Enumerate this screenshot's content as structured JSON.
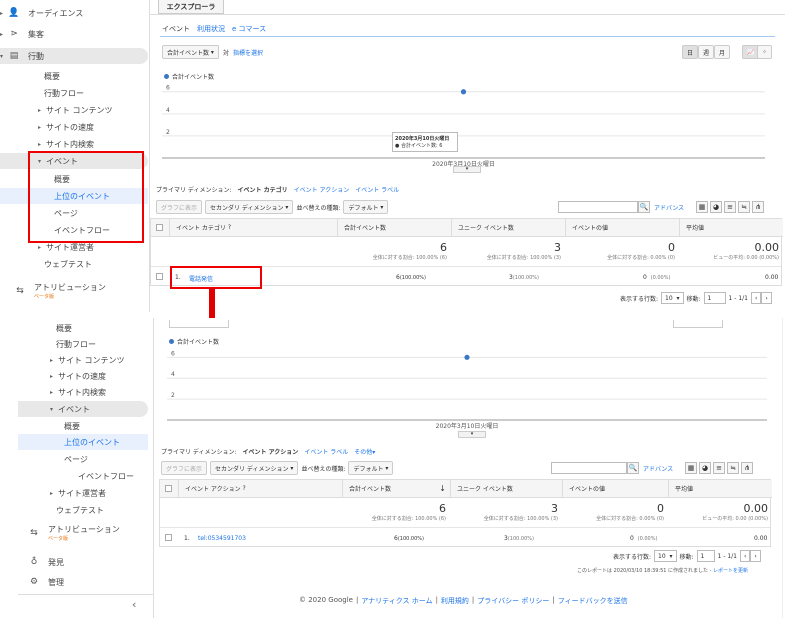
{
  "top_sidebar": {
    "items": [
      {
        "label": "オーディエンス",
        "icon": "person-icon"
      },
      {
        "label": "集客",
        "icon": "acquisition-icon"
      },
      {
        "label": "行動",
        "icon": "behavior-icon"
      },
      {
        "label": "概要"
      },
      {
        "label": "行動フロー"
      },
      {
        "label": "サイト コンテンツ"
      },
      {
        "label": "サイトの速度"
      },
      {
        "label": "サイト内検索"
      },
      {
        "label": "イベント"
      },
      {
        "label": "概要"
      },
      {
        "label": "上位のイベント"
      },
      {
        "label": "ページ"
      },
      {
        "label": "イベントフロー"
      },
      {
        "label": "サイト運営者"
      },
      {
        "label": "ウェブテスト"
      },
      {
        "label": "アトリビューション",
        "beta": "ベータ版"
      }
    ]
  },
  "top_panel": {
    "explorer_tab": "エクスプローラ",
    "subtabs": [
      "イベント",
      "利用状況",
      "e コマース"
    ],
    "metric_select": "合計イベント数",
    "vs_label": "対",
    "select_metric": "指標を選択",
    "period_buttons": [
      "日",
      "週",
      "月"
    ],
    "legend": "合計イベント数",
    "tooltip_date": "2020年3月10日火曜日",
    "tooltip_value": "● 合計イベント数: 6",
    "x_label": "2020年3月10日火曜日",
    "primary_dimension_label": "プライマリ ディメンション:",
    "dimensions": [
      "イベント カテゴリ",
      "イベント アクション",
      "イベント ラベル"
    ],
    "plot_rows": "グラフに表示",
    "secondary_dimension": "セカンダリ ディメンション",
    "sort_type": "並べ替えの種類:",
    "sort_default": "デフォルト",
    "advanced": "アドバンス",
    "headers": [
      "イベント カテゴリ",
      "合計イベント数",
      "ユニーク イベント数",
      "イベントの値",
      "平均値"
    ],
    "totals": [
      {
        "big": "6",
        "sub": "全体に対する割合: 100.00% (6)"
      },
      {
        "big": "3",
        "sub": "全体に対する割合: 100.00% (3)"
      },
      {
        "big": "0",
        "sub": "全体に対する割合: 0.00% (0)"
      },
      {
        "big": "0.00",
        "sub": "ビューの平均: 0.00 (0.00%)"
      }
    ],
    "row": {
      "num": "1.",
      "name": "電話発信",
      "total": "6",
      "total_pct": "(100.00%)",
      "unique": "3",
      "unique_pct": "(100.00%)",
      "value": "0",
      "value_pct": "(0.00%)",
      "avg": "0.00"
    },
    "rows_label": "表示する行数:",
    "rows_value": "10",
    "move_label": "移動:",
    "move_value": "1",
    "range": "1 - 1/1"
  },
  "bottom_sidebar": {
    "items": [
      {
        "label": "概要"
      },
      {
        "label": "行動フロー"
      },
      {
        "label": "サイト コンテンツ"
      },
      {
        "label": "サイトの速度"
      },
      {
        "label": "サイト内検索"
      },
      {
        "label": "イベント"
      },
      {
        "label": "概要"
      },
      {
        "label": "上位のイベント"
      },
      {
        "label": "ページ"
      },
      {
        "label": "イベントフロー"
      },
      {
        "label": "サイト運営者"
      },
      {
        "label": "ウェブテスト"
      },
      {
        "label": "アトリビューション",
        "beta": "ベータ版"
      },
      {
        "label": "発見",
        "icon": "lightbulb-icon"
      },
      {
        "label": "管理",
        "icon": "gear-icon"
      }
    ],
    "collapse": "‹"
  },
  "bottom_panel": {
    "legend": "合計イベント数",
    "x_label": "2020年3月10日火曜日",
    "primary_dimension_label": "プライマリ ディメンション:",
    "dimensions": [
      "イベント アクション",
      "イベント ラベル",
      "その他"
    ],
    "plot_rows": "グラフに表示",
    "secondary_dimension": "セカンダリ ディメンション",
    "sort_type": "並べ替えの種類:",
    "sort_default": "デフォルト",
    "advanced": "アドバンス",
    "headers": [
      "イベント アクション",
      "合計イベント数",
      "ユニーク イベント数",
      "イベントの値",
      "平均値"
    ],
    "totals": [
      {
        "big": "6",
        "sub": "全体に対する割合: 100.00% (6)"
      },
      {
        "big": "3",
        "sub": "全体に対する割合: 100.00% (3)"
      },
      {
        "big": "0",
        "sub": "全体に対する割合: 0.00% (0)"
      },
      {
        "big": "0.00",
        "sub": "ビューの平均: 0.00 (0.00%)"
      }
    ],
    "row": {
      "num": "1.",
      "name": "tel:0534591703",
      "total": "6",
      "total_pct": "(100.00%)",
      "unique": "3",
      "unique_pct": "(100.00%)",
      "value": "0",
      "value_pct": "(0.00%)",
      "avg": "0.00"
    },
    "rows_label": "表示する行数:",
    "rows_value": "10",
    "move_label": "移動:",
    "move_value": "1",
    "range": "1 - 1/1",
    "report_created": "このレポートは 2020/03/10 18:39:51 に作成されました -",
    "refresh": "レポートを更新",
    "footer": [
      "© 2020 Google",
      "アナリティクス ホーム",
      "利用規約",
      "プライバシー ポリシー",
      "フィードバックを送信"
    ]
  },
  "chart_data": [
    {
      "type": "line",
      "x": [
        "2020年3月10日火曜日"
      ],
      "series": [
        {
          "name": "合計イベント数",
          "values": [
            6
          ]
        }
      ],
      "y_ticks": [
        2,
        4,
        6
      ]
    },
    {
      "type": "line",
      "x": [
        "2020年3月10日火曜日"
      ],
      "series": [
        {
          "name": "合計イベント数",
          "values": [
            6
          ]
        }
      ],
      "y_ticks": [
        2,
        4,
        6
      ]
    }
  ],
  "colors": {
    "accent": "#1a73e8",
    "highlight": "#e00000",
    "point": "#3b78c3"
  }
}
